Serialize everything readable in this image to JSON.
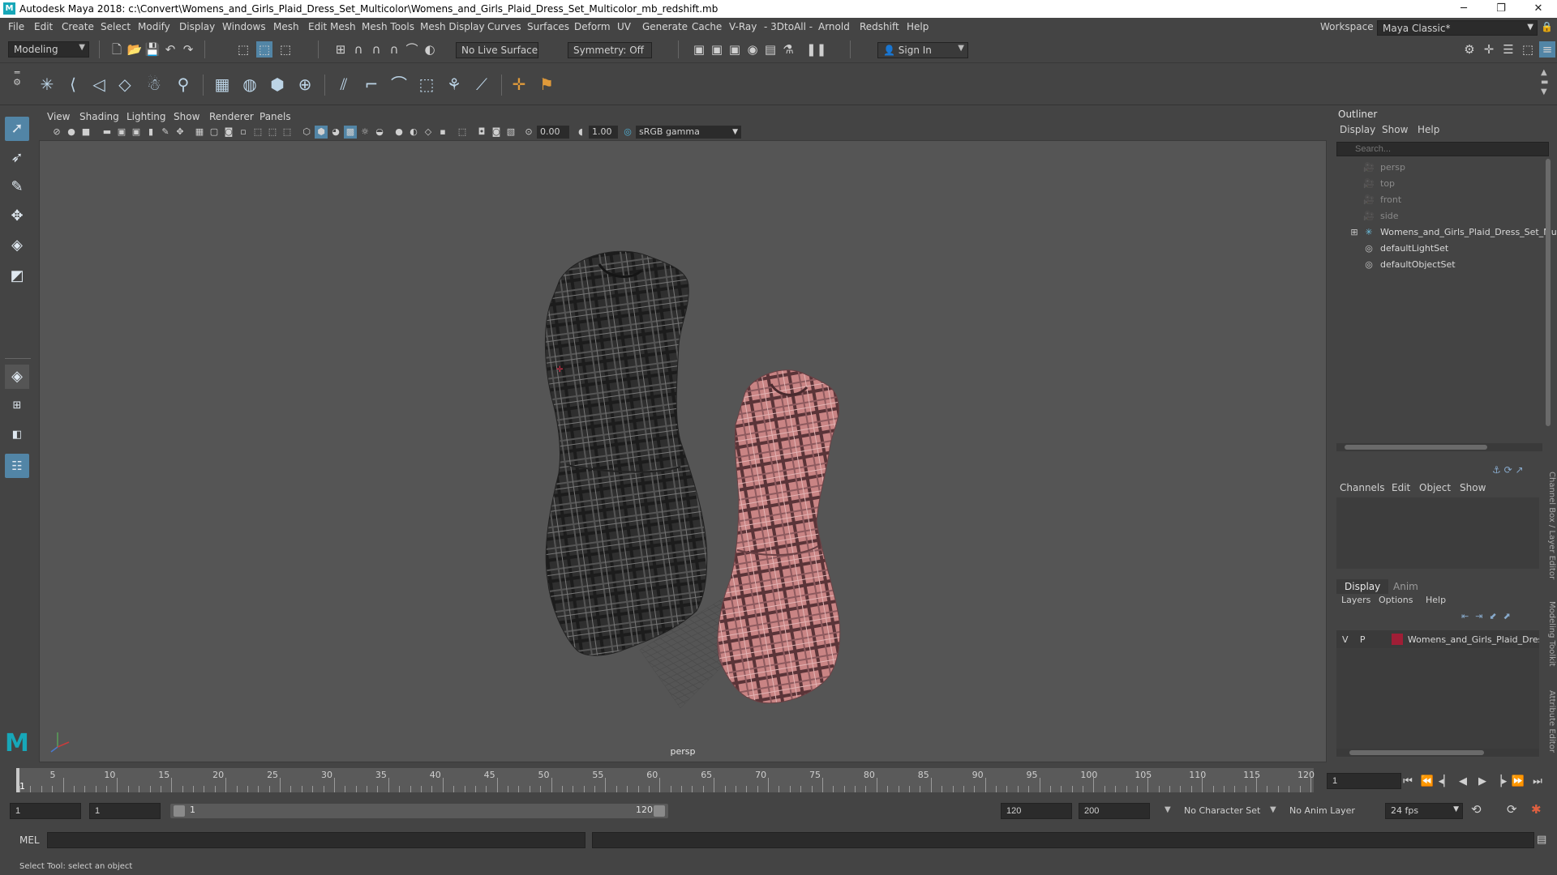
{
  "window": {
    "title": "Autodesk Maya 2018: c:\\Convert\\Womens_and_Girls_Plaid_Dress_Set_Multicolor\\Womens_and_Girls_Plaid_Dress_Set_Multicolor_mb_redshift.mb",
    "logo": "M",
    "minimize": "─",
    "restore": "❐",
    "close": "✕"
  },
  "menubar": {
    "items": [
      "File",
      "Edit",
      "Create",
      "Select",
      "Modify",
      "Display",
      "Windows",
      "Mesh",
      "Edit Mesh",
      "Mesh Tools",
      "Mesh Display",
      "Curves",
      "Surfaces",
      "Deform",
      "UV",
      "Generate",
      "Cache",
      "V-Ray",
      "- 3DtoAll -",
      "Arnold",
      "Redshift",
      "Help"
    ],
    "workspace_label": "Workspace :",
    "workspace_value": "Maya Classic*"
  },
  "statusline": {
    "mode": "Modeling",
    "live_surface": "No Live Surface",
    "symmetry": "Symmetry: Off",
    "sign_in": "Sign In"
  },
  "viewport": {
    "menus": [
      "View",
      "Shading",
      "Lighting",
      "Show",
      "Renderer",
      "Panels"
    ],
    "exposure": "0.00",
    "gamma": "1.00",
    "color_space": "sRGB gamma",
    "camera_label": "persp"
  },
  "outliner": {
    "title": "Outliner",
    "menus": [
      "Display",
      "Show",
      "Help"
    ],
    "search_placeholder": "Search...",
    "items": [
      {
        "label": "persp",
        "dim": true
      },
      {
        "label": "top",
        "dim": true
      },
      {
        "label": "front",
        "dim": true
      },
      {
        "label": "side",
        "dim": true
      },
      {
        "label": "Womens_and_Girls_Plaid_Dress_Set_Mu",
        "dim": false
      },
      {
        "label": "defaultLightSet",
        "dim": false
      },
      {
        "label": "defaultObjectSet",
        "dim": false
      }
    ],
    "expand_glyph": "⊞"
  },
  "channelbox": {
    "menus": [
      "Channels",
      "Edit",
      "Object",
      "Show"
    ]
  },
  "layers": {
    "tabs": [
      "Display",
      "Anim"
    ],
    "menus": [
      "Layers",
      "Options",
      "Help"
    ],
    "row": {
      "v": "V",
      "p": "P",
      "name": "Womens_and_Girls_Plaid_Dres",
      "color": "#a01e36"
    }
  },
  "side_tabs": [
    "Channel Box / Layer Editor",
    "Modeling Toolkit",
    "Attribute Editor"
  ],
  "timeslider": {
    "labels": [
      "5",
      "10",
      "15",
      "20",
      "25",
      "30",
      "35",
      "40",
      "45",
      "50",
      "55",
      "60",
      "65",
      "70",
      "75",
      "80",
      "85",
      "90",
      "95",
      "100",
      "105",
      "110",
      "115",
      "120"
    ],
    "current_marker": "1",
    "current_frame": "1"
  },
  "range": {
    "start": "1",
    "playback_start": "1",
    "slider_start": "1",
    "slider_end": "120",
    "playback_end": "120",
    "end": "200",
    "character_set": "No Character Set",
    "anim_layer": "No Anim Layer",
    "fps": "24 fps"
  },
  "commandline": {
    "label": "MEL"
  },
  "helpline": {
    "text": "Select Tool: select an object"
  },
  "colors": {
    "accent": "#5285a6",
    "maya_teal": "#17a7b8",
    "plaid_dark": "#3a3a3a",
    "plaid_pink": "#c98484"
  }
}
